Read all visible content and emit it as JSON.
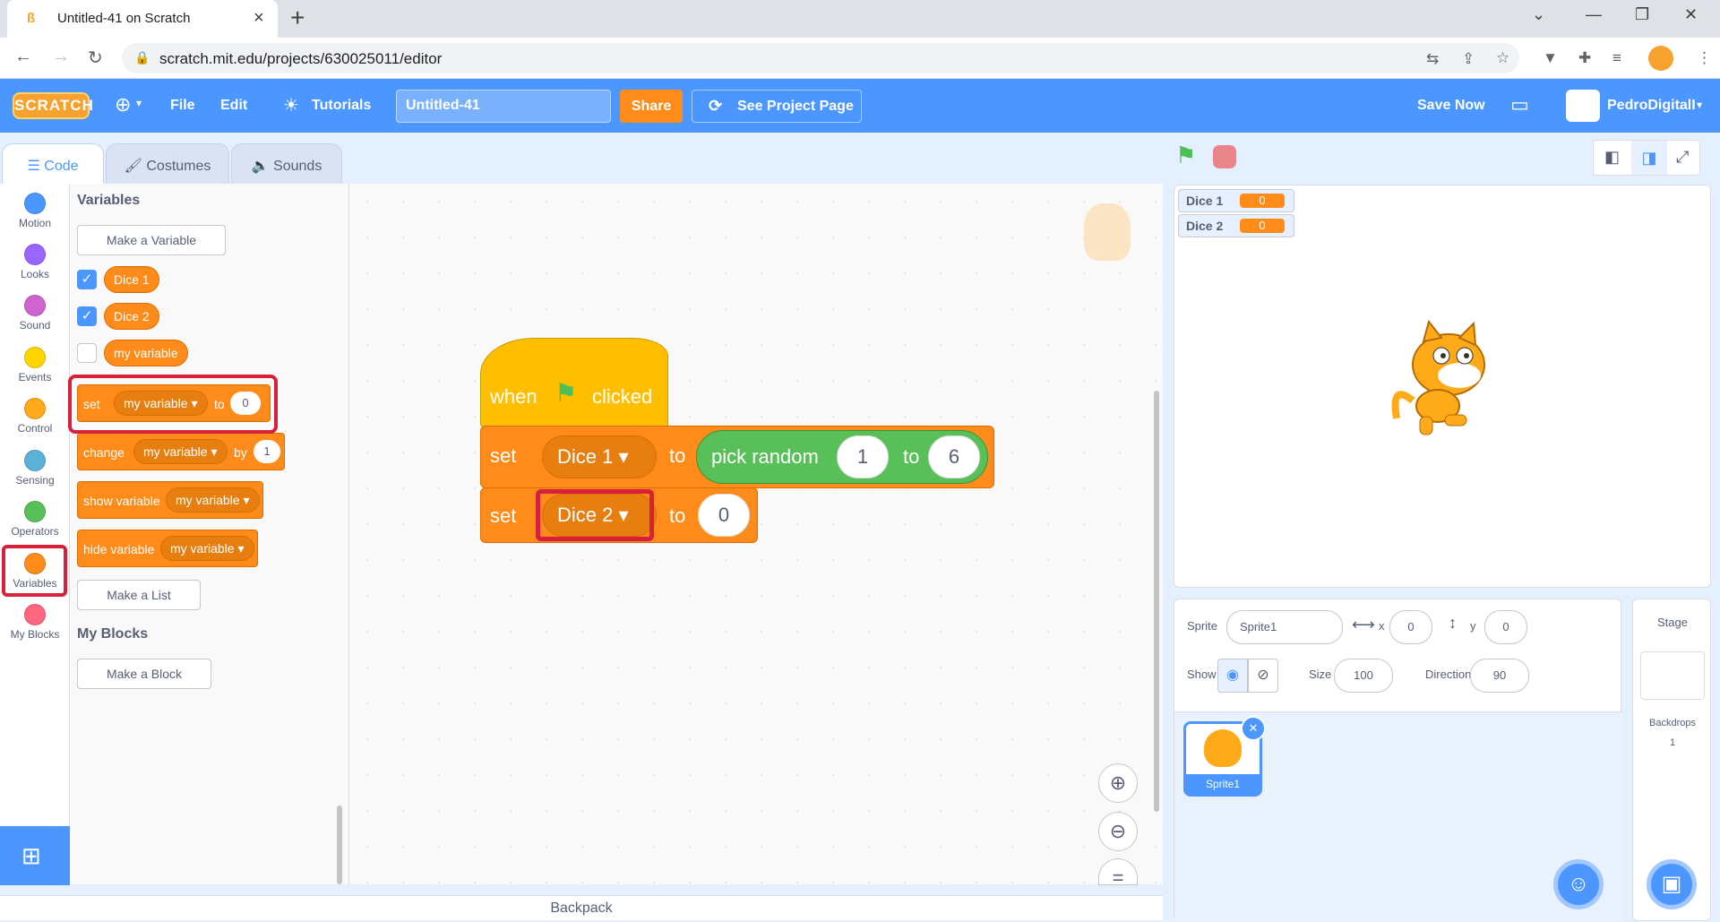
{
  "browser": {
    "tab_title": "Untitled-41 on Scratch",
    "url": "scratch.mit.edu/projects/630025011/editor"
  },
  "menubar": {
    "logo": "SCRATCH",
    "file": "File",
    "edit": "Edit",
    "tutorials": "Tutorials",
    "project_title": "Untitled-41",
    "share": "Share",
    "see_project_page": "See Project Page",
    "save_now": "Save Now",
    "username": "PedroDigitalI"
  },
  "tabs": {
    "code": "Code",
    "costumes": "Costumes",
    "sounds": "Sounds"
  },
  "categories": [
    {
      "label": "Motion",
      "color": "#4c97ff"
    },
    {
      "label": "Looks",
      "color": "#9966ff"
    },
    {
      "label": "Sound",
      "color": "#cf63cf"
    },
    {
      "label": "Events",
      "color": "#ffd500"
    },
    {
      "label": "Control",
      "color": "#ffab19"
    },
    {
      "label": "Sensing",
      "color": "#5cb1d6"
    },
    {
      "label": "Operators",
      "color": "#59c059"
    },
    {
      "label": "Variables",
      "color": "#ff8c1a"
    },
    {
      "label": "My Blocks",
      "color": "#ff6680"
    }
  ],
  "palette": {
    "variables_heading": "Variables",
    "make_variable": "Make a Variable",
    "vars": [
      "Dice 1",
      "Dice 2",
      "my variable"
    ],
    "set_block": {
      "word": "set",
      "var": "my variable",
      "to": "to",
      "value": "0"
    },
    "change_block": {
      "word": "change",
      "var": "my variable",
      "by": "by",
      "value": "1"
    },
    "show_block": {
      "word": "show variable",
      "var": "my variable"
    },
    "hide_block": {
      "word": "hide variable",
      "var": "my variable"
    },
    "make_list": "Make a List",
    "myblocks_heading": "My Blocks",
    "make_block": "Make a Block"
  },
  "script": {
    "hat_when": "when",
    "hat_clicked": "clicked",
    "set1": {
      "word": "set",
      "var": "Dice 1",
      "to": "to",
      "op": "pick random",
      "from": "1",
      "op_to": "to",
      "max": "6"
    },
    "set2": {
      "word": "set",
      "var": "Dice 2",
      "to": "to",
      "value": "0"
    }
  },
  "backpack": "Backpack",
  "stage": {
    "monitors": [
      {
        "name": "Dice 1",
        "value": "0"
      },
      {
        "name": "Dice 2",
        "value": "0"
      }
    ]
  },
  "sprite_info": {
    "sprite_label": "Sprite",
    "sprite_name": "Sprite1",
    "x_label": "x",
    "x": "0",
    "y_label": "y",
    "y": "0",
    "show_label": "Show",
    "size_label": "Size",
    "size": "100",
    "direction_label": "Direction",
    "direction": "90"
  },
  "sprites": [
    {
      "name": "Sprite1"
    }
  ],
  "stage_pane": {
    "title": "Stage",
    "backdrops_label": "Backdrops",
    "backdrops_count": "1"
  }
}
